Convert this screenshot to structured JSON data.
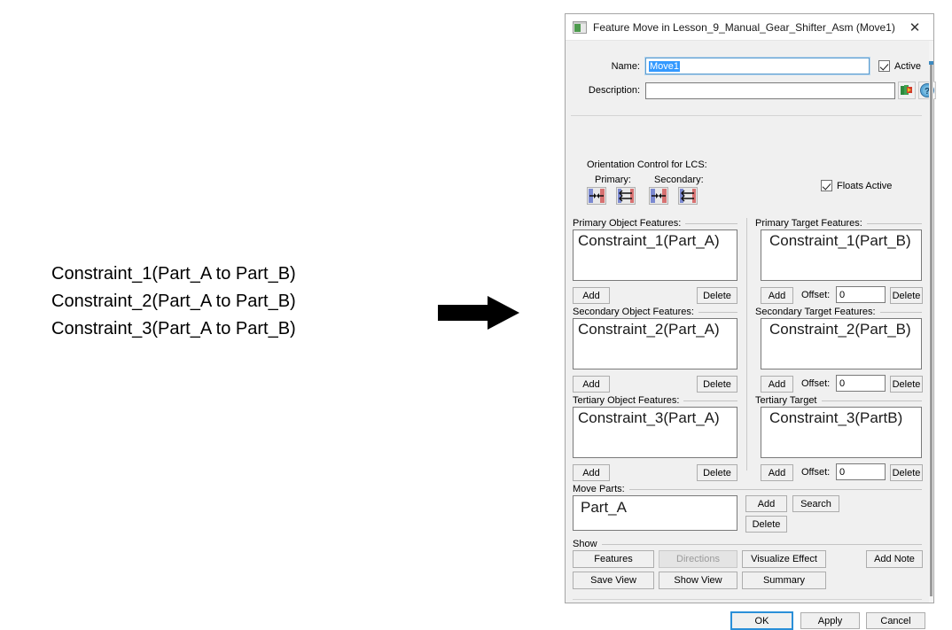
{
  "left_annotation": {
    "lines": [
      "Constraint_1(Part_A to Part_B)",
      "Constraint_2(Part_A to Part_B)",
      "Constraint_3(Part_A to Part_B)"
    ]
  },
  "arrow": {
    "name": "right-arrow",
    "color": "#000000"
  },
  "dialog": {
    "title": "Feature Move in Lesson_9_Manual_Gear_Shifter_Asm (Move1)",
    "close_label": "✕",
    "name_label": "Name:",
    "name_value": "Move1",
    "active_label": "Active",
    "active_checked": true,
    "description_label": "Description:",
    "description_value": "",
    "description_placeholder": "",
    "orientation": {
      "heading": "Orientation Control for LCS:",
      "primary_label": "Primary:",
      "secondary_label": "Secondary:",
      "floats_label": "Floats Active",
      "floats_checked": true
    },
    "groups": [
      {
        "object_legend": "Primary Object Features:",
        "object_value": "Constraint_1(Part_A)",
        "object_add": "Add",
        "object_delete": "Delete",
        "target_legend": "Primary Target Features:",
        "target_value": "Constraint_1(Part_B)",
        "target_add": "Add",
        "offset_label": "Offset:",
        "offset_value": "0",
        "target_delete": "Delete"
      },
      {
        "object_legend": "Secondary Object Features:",
        "object_value": "Constraint_2(Part_A)",
        "object_add": "Add",
        "object_delete": "Delete",
        "target_legend": "Secondary Target Features:",
        "target_value": "Constraint_2(Part_B)",
        "target_add": "Add",
        "offset_label": "Offset:",
        "offset_value": "0",
        "target_delete": "Delete"
      },
      {
        "object_legend": "Tertiary Object Features:",
        "object_value": "Constraint_3(Part_A)",
        "object_add": "Add",
        "object_delete": "Delete",
        "target_legend": "Tertiary Target",
        "target_value": "Constraint_3(PartB)",
        "target_add": "Add",
        "offset_label": "Offset:",
        "offset_value": "0",
        "target_delete": "Delete"
      }
    ],
    "move_parts": {
      "legend": "Move Parts:",
      "value": "Part_A",
      "add": "Add",
      "search": "Search",
      "delete": "Delete"
    },
    "show": {
      "legend": "Show",
      "features": "Features",
      "directions": "Directions",
      "visualize_effect": "Visualize Effect",
      "add_note": "Add Note",
      "save_view": "Save View",
      "show_view": "Show View",
      "summary": "Summary"
    },
    "footer": {
      "ok": "OK",
      "apply": "Apply",
      "cancel": "Cancel"
    },
    "accent_color": "#2a8fd8",
    "selection_color": "#3399ff"
  }
}
